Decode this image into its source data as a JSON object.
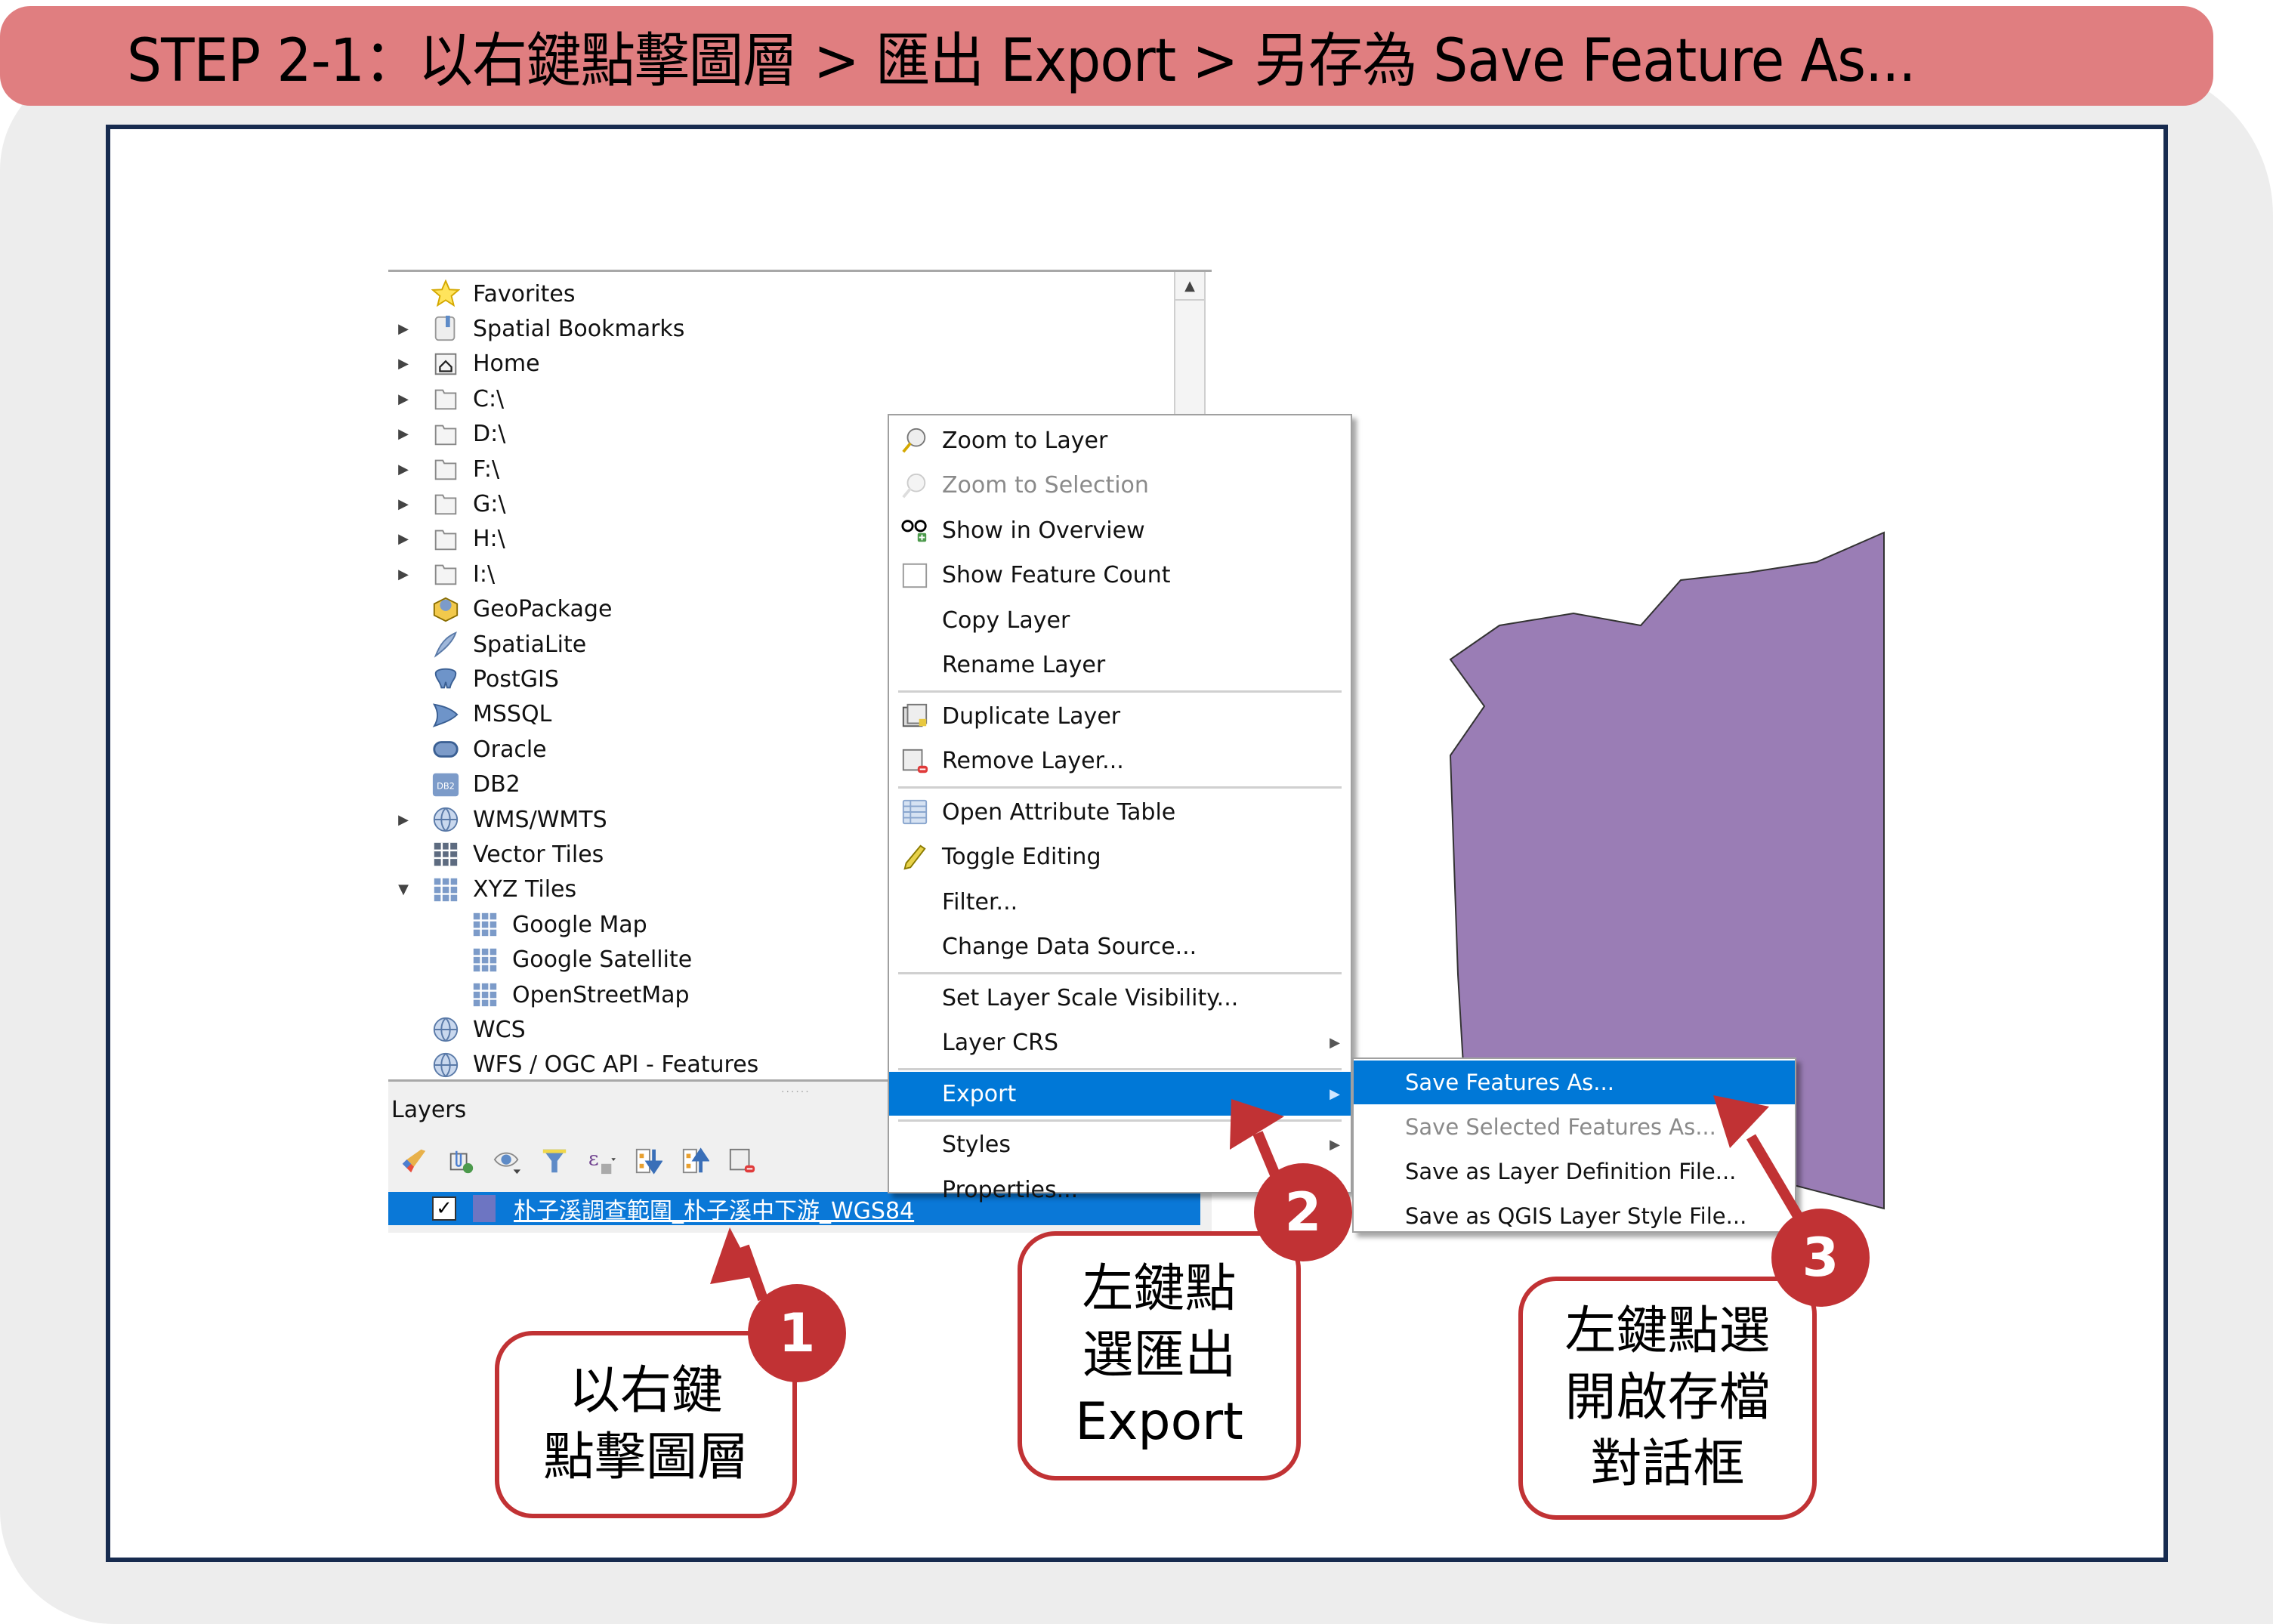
{
  "title": "STEP 2-1：以右鍵點擊圖層 >  匯出 Export > 另存為 Save Feature As...",
  "colors": {
    "title_bar": "#E07E80",
    "frame_border": "#172B4F",
    "background": "#EDEDED",
    "highlight": "#0078D7",
    "callout_red": "#C13234",
    "polygon_fill": "#9A7DB5",
    "layer_swatch": "#6D75C2"
  },
  "browser": {
    "items": [
      {
        "label": "Favorites",
        "icon": "star-icon",
        "expandable": false,
        "expanded": false,
        "indent": 0
      },
      {
        "label": "Spatial Bookmarks",
        "icon": "bookmark-icon",
        "expandable": true,
        "expanded": false,
        "indent": 0
      },
      {
        "label": "Home",
        "icon": "home-folder-icon",
        "expandable": true,
        "expanded": false,
        "indent": 0
      },
      {
        "label": "C:\\",
        "icon": "folder-icon",
        "expandable": true,
        "expanded": false,
        "indent": 0
      },
      {
        "label": "D:\\",
        "icon": "folder-icon",
        "expandable": true,
        "expanded": false,
        "indent": 0
      },
      {
        "label": "F:\\",
        "icon": "folder-icon",
        "expandable": true,
        "expanded": false,
        "indent": 0
      },
      {
        "label": "G:\\",
        "icon": "folder-icon",
        "expandable": true,
        "expanded": false,
        "indent": 0
      },
      {
        "label": "H:\\",
        "icon": "folder-icon",
        "expandable": true,
        "expanded": false,
        "indent": 0
      },
      {
        "label": "I:\\",
        "icon": "folder-icon",
        "expandable": true,
        "expanded": false,
        "indent": 0
      },
      {
        "label": "GeoPackage",
        "icon": "geopackage-icon",
        "expandable": false,
        "expanded": false,
        "indent": 0
      },
      {
        "label": "SpatiaLite",
        "icon": "spatialite-feather-icon",
        "expandable": false,
        "expanded": false,
        "indent": 0
      },
      {
        "label": "PostGIS",
        "icon": "postgis-elephant-icon",
        "expandable": false,
        "expanded": false,
        "indent": 0
      },
      {
        "label": "MSSQL",
        "icon": "mssql-icon",
        "expandable": false,
        "expanded": false,
        "indent": 0
      },
      {
        "label": "Oracle",
        "icon": "oracle-icon",
        "expandable": false,
        "expanded": false,
        "indent": 0
      },
      {
        "label": "DB2",
        "icon": "db2-icon",
        "expandable": false,
        "expanded": false,
        "indent": 0
      },
      {
        "label": "WMS/WMTS",
        "icon": "globe-icon",
        "expandable": true,
        "expanded": false,
        "indent": 0
      },
      {
        "label": "Vector Tiles",
        "icon": "vector-tiles-grid-icon",
        "expandable": false,
        "expanded": false,
        "indent": 0
      },
      {
        "label": "XYZ Tiles",
        "icon": "xyz-tiles-grid-icon",
        "expandable": true,
        "expanded": true,
        "indent": 0
      },
      {
        "label": "Google Map",
        "icon": "xyz-tiles-grid-icon",
        "expandable": false,
        "expanded": false,
        "indent": 1
      },
      {
        "label": "Google Satellite",
        "icon": "xyz-tiles-grid-icon",
        "expandable": false,
        "expanded": false,
        "indent": 1
      },
      {
        "label": "OpenStreetMap",
        "icon": "xyz-tiles-grid-icon",
        "expandable": false,
        "expanded": false,
        "indent": 1
      },
      {
        "label": "WCS",
        "icon": "wcs-globe-icon",
        "expandable": false,
        "expanded": false,
        "indent": 0
      },
      {
        "label": "WFS / OGC API - Features",
        "icon": "wfs-globe-icon",
        "expandable": false,
        "expanded": false,
        "indent": 0
      }
    ]
  },
  "layers_panel": {
    "title": "Layers",
    "toolbar": [
      "style-manager-icon",
      "add-group-icon",
      "manage-visibility-icon",
      "filter-legend-icon",
      "filter-by-expression-icon",
      "expand-all-icon",
      "collapse-all-icon",
      "remove-layer-icon"
    ],
    "layer": {
      "name": "朴子溪調查範圍_朴子溪中下游_WGS84",
      "checked": true
    }
  },
  "context_menu": {
    "items": [
      {
        "type": "item",
        "label": "Zoom to Layer",
        "accel": "Z",
        "icon": "zoom-layer-icon",
        "disabled": false
      },
      {
        "type": "item",
        "label": "Zoom to Selection",
        "accel": "Z",
        "icon": "zoom-selection-icon",
        "disabled": true
      },
      {
        "type": "item",
        "label": "Show in Overview",
        "accel": "S",
        "icon": "overview-glasses-icon",
        "disabled": false
      },
      {
        "type": "item",
        "label": "Show Feature Count",
        "accel": "",
        "icon": "checkbox-icon",
        "disabled": false
      },
      {
        "type": "item",
        "label": "Copy Layer",
        "accel": "",
        "icon": "",
        "disabled": false
      },
      {
        "type": "item",
        "label": "Rename Layer",
        "accel": "n",
        "icon": "",
        "disabled": false
      },
      {
        "type": "separator"
      },
      {
        "type": "item",
        "label": "Duplicate Layer",
        "accel": "D",
        "icon": "duplicate-layer-icon",
        "disabled": false
      },
      {
        "type": "item",
        "label": "Remove Layer...",
        "accel": "R",
        "icon": "remove-layer-icon",
        "disabled": false
      },
      {
        "type": "separator"
      },
      {
        "type": "item",
        "label": "Open Attribute Table",
        "accel": "O",
        "icon": "attribute-table-icon",
        "disabled": false
      },
      {
        "type": "item",
        "label": "Toggle Editing",
        "accel": "",
        "icon": "pencil-icon",
        "disabled": false
      },
      {
        "type": "item",
        "label": "Filter...",
        "accel": "F",
        "icon": "",
        "disabled": false
      },
      {
        "type": "item",
        "label": "Change Data Source...",
        "accel": "",
        "icon": "",
        "disabled": false
      },
      {
        "type": "separator"
      },
      {
        "type": "item",
        "label": "Set Layer Scale Visibility...",
        "accel": "S",
        "icon": "",
        "disabled": false
      },
      {
        "type": "item",
        "label": "Layer CRS",
        "accel": "",
        "icon": "",
        "disabled": false,
        "submenu": true
      },
      {
        "type": "separator"
      },
      {
        "type": "item",
        "label": "Export",
        "accel": "",
        "icon": "",
        "disabled": false,
        "submenu": true,
        "active": true
      },
      {
        "type": "separator"
      },
      {
        "type": "item",
        "label": "Styles",
        "accel": "",
        "icon": "",
        "disabled": false,
        "submenu": true
      },
      {
        "type": "item",
        "label": "Properties...",
        "accel": "P",
        "icon": "",
        "disabled": false
      }
    ]
  },
  "export_submenu": {
    "items": [
      {
        "label": "Save Features As...",
        "active": true,
        "disabled": false
      },
      {
        "label": "Save Selected Features As...",
        "active": false,
        "disabled": true
      },
      {
        "label": "Save as Layer Definition File...",
        "active": false,
        "disabled": false
      },
      {
        "label": "Save as QGIS Layer Style File...",
        "active": false,
        "disabled": false
      }
    ]
  },
  "callouts": [
    {
      "number": "1",
      "text": "以右鍵\n點擊圖層"
    },
    {
      "number": "2",
      "text": "左鍵點\n選匯出\nExport"
    },
    {
      "number": "3",
      "text": "左鍵點選\n開啟存檔\n對話框"
    }
  ]
}
